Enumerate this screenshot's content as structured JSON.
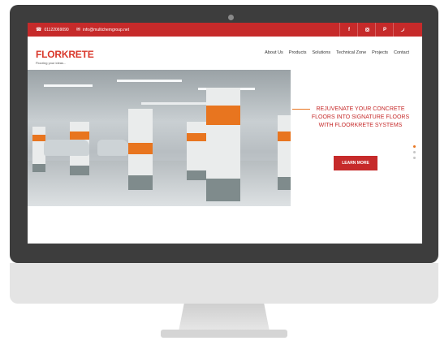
{
  "topbar": {
    "phone": "01122069090",
    "email": "info@multichemgroup.net",
    "social": [
      "f",
      "ig",
      "p",
      "tw"
    ]
  },
  "logo": {
    "text": "FLORKRETE",
    "tagline": "Flooring your ideas..."
  },
  "nav": [
    "About Us",
    "Products",
    "Solutions",
    "Technical Zone",
    "Projects",
    "Contact"
  ],
  "hero": {
    "tagline": "REJUVENATE YOUR CONCRETE FLOORS INTO SIGNATURE FLOORS WITH FLOORKRETE SYSTEMS",
    "cta_label": "LEARN MORE",
    "slide_count": 3,
    "active_slide": 1
  },
  "colors": {
    "brand": "#c62a2a",
    "accent": "#e8751f"
  }
}
